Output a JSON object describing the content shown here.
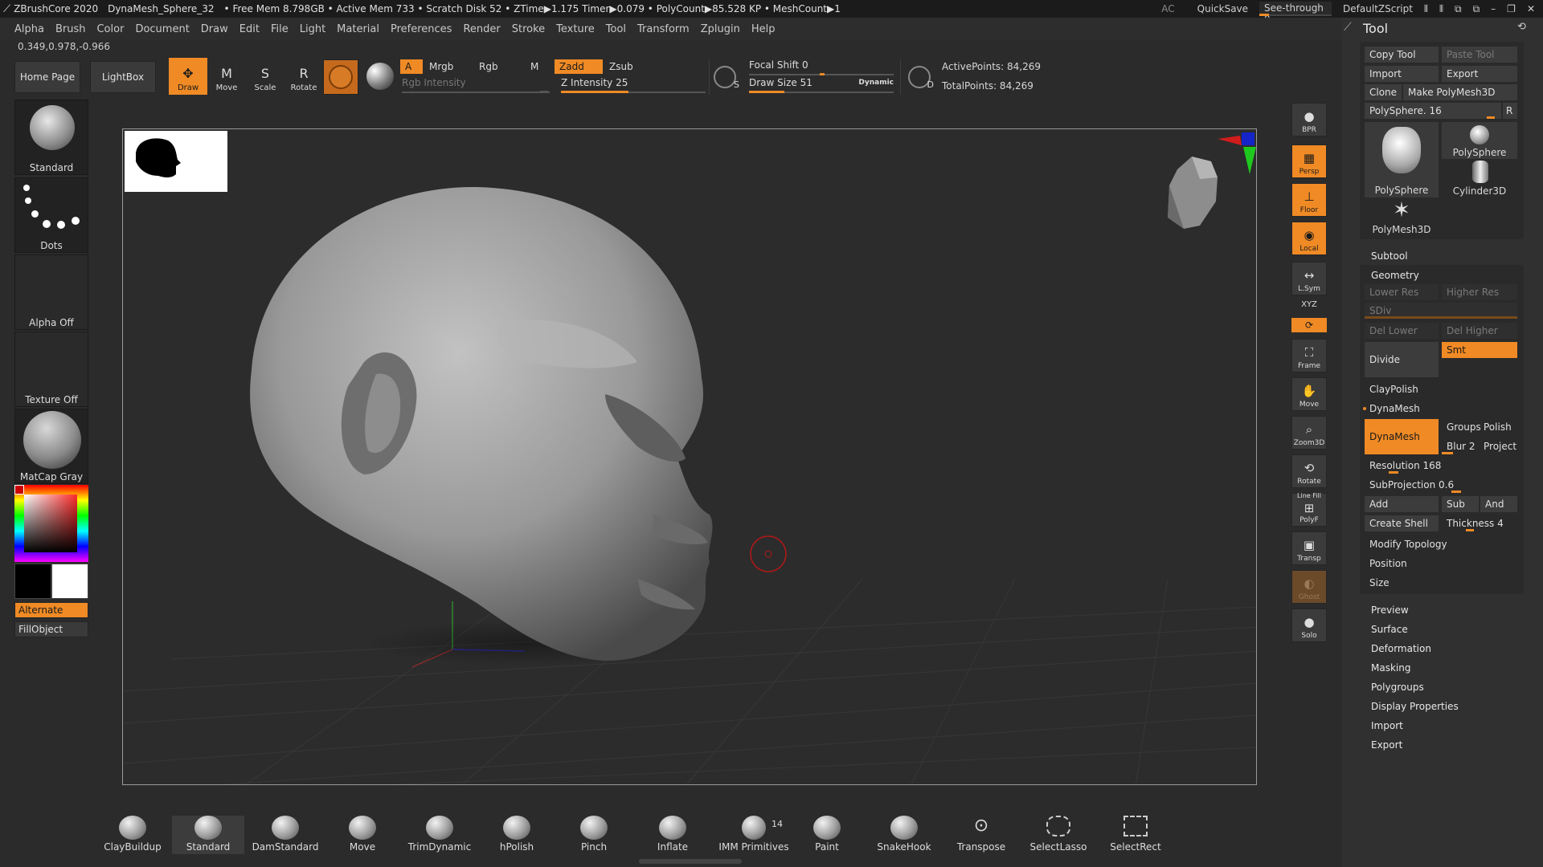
{
  "titlebar": {
    "app": "ZBrushCore 2020",
    "doc": "DynaMesh_Sphere_32",
    "stats": "• Free Mem 8.798GB • Active Mem 733 • Scratch Disk 52 • ZTime▶1.175 Timer▶0.079 • PolyCount▶85.528 KP • MeshCount▶1",
    "ac": "AC",
    "quicksave": "QuickSave",
    "seethrough": "See-through  0",
    "script": "DefaultZScript"
  },
  "menu": [
    "Alpha",
    "Brush",
    "Color",
    "Document",
    "Draw",
    "Edit",
    "File",
    "Light",
    "Material",
    "Preferences",
    "Render",
    "Stroke",
    "Texture",
    "Tool",
    "Transform",
    "Zplugin",
    "Help"
  ],
  "coords": "0.349,0.978,-0.966",
  "toolbar": {
    "home": "Home Page",
    "lightbox": "LightBox",
    "draw": "Draw",
    "move": "Move",
    "scale": "Scale",
    "rotate": "Rotate",
    "a": "A",
    "mrgb": "Mrgb",
    "rgb": "Rgb",
    "m": "M",
    "rgb_intensity": "Rgb Intensity",
    "zadd": "Zadd",
    "zsub": "Zsub",
    "z_intensity": "Z Intensity 25",
    "z_intensity_value": 25,
    "focal_shift": "Focal Shift 0",
    "draw_size": "Draw Size 51",
    "draw_size_value": 51,
    "dynamic": "Dynamic",
    "s": "S",
    "d": "D",
    "active_points": "ActivePoints: 84,269",
    "total_points": "TotalPoints: 84,269"
  },
  "left": {
    "brush": "Standard",
    "stroke": "Dots",
    "alpha": "Alpha Off",
    "texture": "Texture Off",
    "material": "MatCap Gray",
    "alternate": "Alternate",
    "fillobject": "FillObject"
  },
  "right_shelf": [
    "BPR",
    "Persp",
    "Floor",
    "Local",
    "L.Sym",
    "XYZ",
    "Frame",
    "Move",
    "Zoom3D",
    "Rotate",
    "PolyF",
    "Transp",
    "Ghost",
    "Solo"
  ],
  "right_shelf_extra": {
    "linefill": "Line Fill"
  },
  "tool": {
    "title": "Tool",
    "copy": "Copy Tool",
    "paste": "Paste Tool",
    "import": "Import",
    "export": "Export",
    "clone": "Clone",
    "make": "Make PolyMesh3D",
    "polysphere": "PolySphere. 16",
    "r": "R",
    "thumbs": [
      "PolySphere",
      "PolySphere",
      "Cylinder3D",
      "PolyMesh3D"
    ],
    "subtool": "Subtool",
    "geometry": "Geometry",
    "lower": "Lower Res",
    "higher": "Higher Res",
    "sdiv": "SDiv",
    "del_lower": "Del Lower",
    "del_higher": "Del Higher",
    "divide": "Divide",
    "smt": "Smt",
    "claypolish": "ClayPolish",
    "dynamesh_head": "DynaMesh",
    "dynamesh": "DynaMesh",
    "groups": "Groups",
    "polish": "Polish",
    "blur": "Blur 2",
    "project": "Project",
    "resolution": "Resolution 168",
    "subprojection": "SubProjection 0.6",
    "add": "Add",
    "sub": "Sub",
    "and": "And",
    "create_shell": "Create Shell",
    "thickness": "Thickness 4",
    "modify": "Modify Topology",
    "position": "Position",
    "size": "Size",
    "sections": [
      "Preview",
      "Surface",
      "Deformation",
      "Masking",
      "Polygroups",
      "Display Properties",
      "Import",
      "Export"
    ]
  },
  "bottom": [
    "ClayBuildup",
    "Standard",
    "DamStandard",
    "Move",
    "TrimDynamic",
    "hPolish",
    "Pinch",
    "Inflate",
    "IMM Primitives",
    "Paint",
    "SnakeHook",
    "Transpose",
    "SelectLasso",
    "SelectRect"
  ],
  "bottom_imm_count": "14",
  "colors": {
    "accent": "#ef8a25",
    "bg": "#2b2b2b",
    "canvas": "#2c2c2c"
  }
}
